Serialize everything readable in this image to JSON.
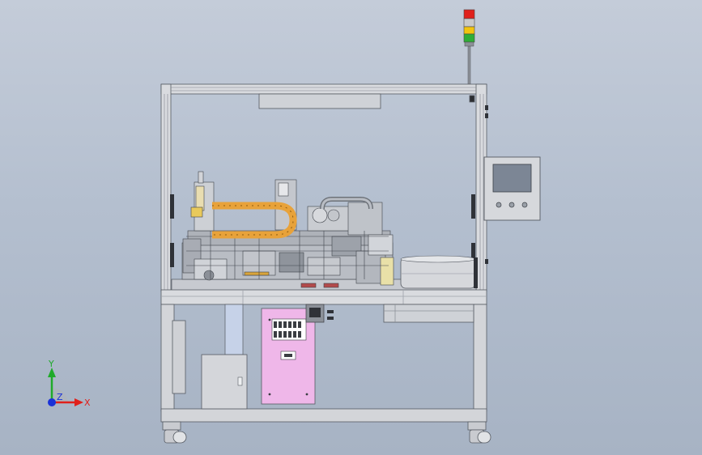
{
  "triad": {
    "x_label": "X",
    "y_label": "Y",
    "z_label": "Z"
  },
  "colors": {
    "background_top": "#c4ccd9",
    "background_bottom": "#a7b3c4",
    "frame": "#d9dbdf",
    "frame_edge": "#555a62",
    "cable_chain": "#e8a23a",
    "electrical_panel": "#efb7e9",
    "hmi_screen": "#7c8695",
    "stack_light_red": "#e0201b",
    "stack_light_yellow": "#f2c40f",
    "stack_light_green": "#2fae36",
    "axis_x": "#e0201b",
    "axis_y": "#1faa2a",
    "axis_z": "#1a32d8"
  }
}
